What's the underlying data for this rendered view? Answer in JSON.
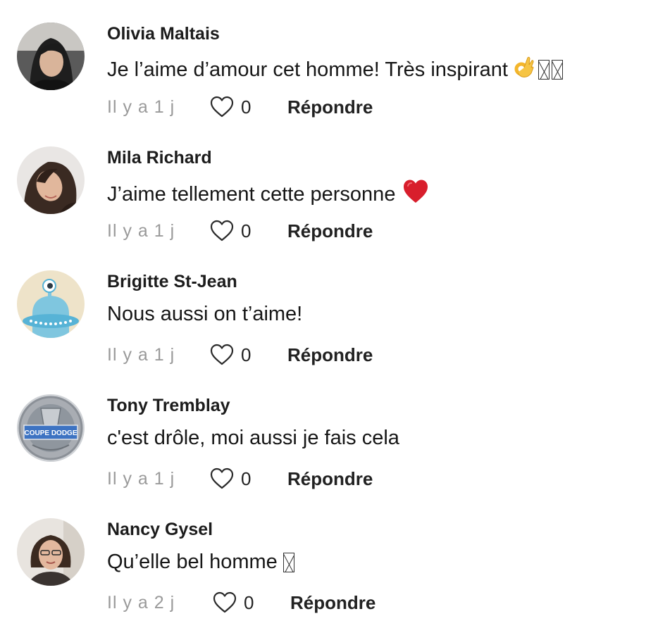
{
  "comments": [
    {
      "author": "Olivia Maltais",
      "text": "Je l’aime d’amour cet homme! Très inspirant",
      "emoji": [
        "ok-hand-emoji",
        "unrendered-glyph",
        "unrendered-glyph"
      ],
      "time": "Il y a 1 j",
      "likes": "0",
      "reply": "Répondre"
    },
    {
      "author": "Mila Richard",
      "text": "J’aime tellement cette personne",
      "emoji": [
        "red-heart-emoji"
      ],
      "time": "Il y a 1 j",
      "likes": "0",
      "reply": "Répondre"
    },
    {
      "author": "Brigitte St-Jean",
      "text": "Nous aussi on t’aime!",
      "emoji": [],
      "time": "Il y a 1 j",
      "likes": "0",
      "reply": "Répondre"
    },
    {
      "author": "Tony Tremblay",
      "text": "c'est drôle, moi aussi je fais cela",
      "emoji": [],
      "time": "Il y a 1 j",
      "likes": "0",
      "reply": "Répondre"
    },
    {
      "author": "Nancy Gysel",
      "text": "Qu’elle bel homme",
      "emoji": [
        "unrendered-glyph"
      ],
      "time": "Il y a 2 j",
      "likes": "0",
      "reply": "Répondre"
    }
  ],
  "avatar_badge_text": "COUPE DODGE",
  "colors": {
    "author": "#1c1c1c",
    "time": "#9a9a9a",
    "reply": "#222222",
    "heart_red": "#d81e2c"
  },
  "icons": {
    "like": "heart-outline-icon"
  }
}
